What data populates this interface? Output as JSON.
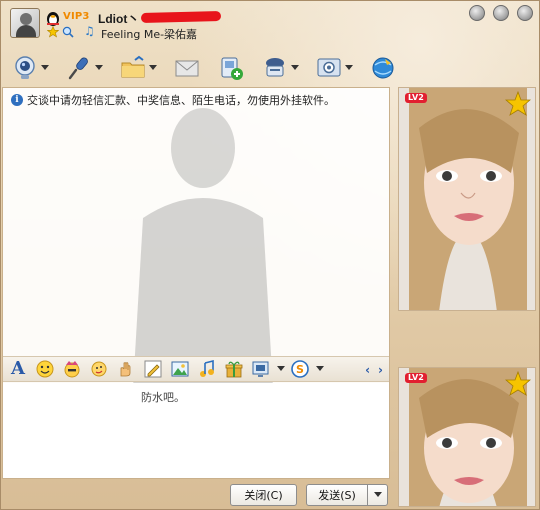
{
  "header": {
    "vip_label": "VIP3",
    "nickname": "Ldiot丶",
    "signature": "Feeling Me-梁佑嘉"
  },
  "toolbar": {
    "items": [
      {
        "icon": "webcam-icon",
        "has_dropdown": true
      },
      {
        "icon": "microphone-icon",
        "has_dropdown": true
      },
      {
        "icon": "folder-icon",
        "has_dropdown": true
      },
      {
        "icon": "mail-icon",
        "has_dropdown": false
      },
      {
        "icon": "sms-add-icon",
        "has_dropdown": false
      },
      {
        "icon": "remote-assist-icon",
        "has_dropdown": true
      },
      {
        "icon": "app-settings-icon",
        "has_dropdown": true
      },
      {
        "icon": "globe-app-icon",
        "has_dropdown": false
      }
    ]
  },
  "chat": {
    "security_notice": "交谈中请勿轻信汇款、中奖信息、陌生电话，勿使用外挂软件。"
  },
  "input": {
    "text": "防水吧。"
  },
  "buttons": {
    "close_label": "关闭(C)",
    "send_label": "发送(S)"
  },
  "photos": {
    "badge_label": "LV2"
  },
  "colors": {
    "accent": "#2a5aa8",
    "vip": "#f08a00",
    "redaction": "#e8141b"
  }
}
